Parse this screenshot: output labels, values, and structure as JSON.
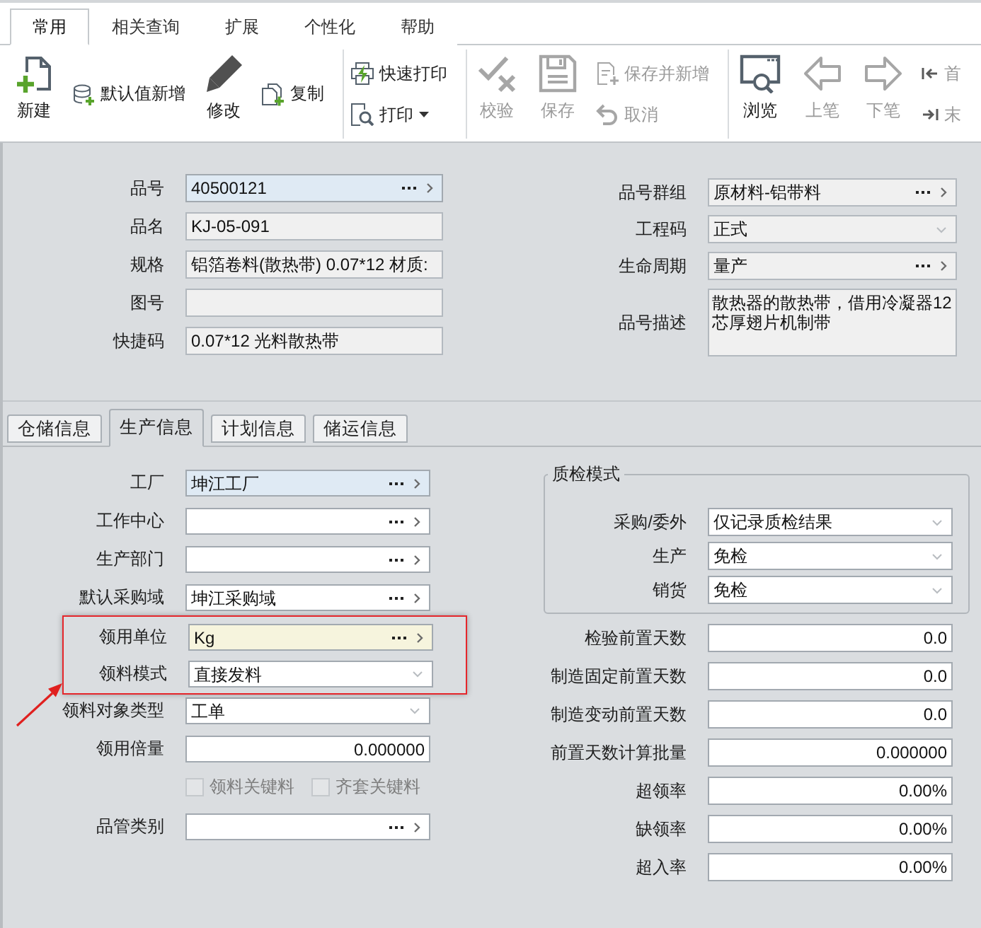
{
  "ribbon_tabs": [
    {
      "label": "常用",
      "selected": true
    },
    {
      "label": "相关查询",
      "selected": false
    },
    {
      "label": "扩展",
      "selected": false
    },
    {
      "label": "个性化",
      "selected": false
    },
    {
      "label": "帮助",
      "selected": false
    }
  ],
  "ribbon_groups": [
    {
      "items": [
        {
          "kind": "large",
          "label": "新建",
          "disabled": false
        },
        {
          "kind": "stack",
          "items": [
            {
              "label": "默认值新增",
              "disabled": false,
              "dropdown": false
            }
          ]
        },
        {
          "kind": "large",
          "label": "修改",
          "disabled": false
        },
        {
          "kind": "stack",
          "items": [
            {
              "label": "复制",
              "disabled": false,
              "dropdown": false
            }
          ]
        }
      ]
    },
    {
      "items": [
        {
          "kind": "stack",
          "items": [
            {
              "label": "快速打印",
              "disabled": false,
              "dropdown": false
            },
            {
              "label": "打印",
              "disabled": false,
              "dropdown": true
            }
          ]
        }
      ]
    },
    {
      "items": [
        {
          "kind": "large",
          "label": "校验",
          "disabled": true
        },
        {
          "kind": "large",
          "label": "保存",
          "disabled": true
        },
        {
          "kind": "stack",
          "items": [
            {
              "label": "保存并新增",
              "disabled": true,
              "dropdown": false
            },
            {
              "label": "取消",
              "disabled": true,
              "dropdown": false
            }
          ]
        }
      ]
    },
    {
      "items": [
        {
          "kind": "large",
          "label": "浏览",
          "disabled": false
        },
        {
          "kind": "large",
          "label": "上笔",
          "disabled": true
        },
        {
          "kind": "large",
          "label": "下笔",
          "disabled": true
        },
        {
          "kind": "stack",
          "items": [
            {
              "label": "首",
              "disabled": true,
              "dropdown": false
            },
            {
              "label": "末",
              "disabled": true,
              "dropdown": false
            }
          ]
        }
      ]
    }
  ],
  "header": {
    "left_fields": [
      {
        "label": "品号",
        "value": "40500121",
        "kind": "lookup",
        "required": true,
        "readonly": false,
        "focused": false
      },
      {
        "label": "品名",
        "value": "KJ-05-091",
        "kind": "text",
        "required": false,
        "readonly": true,
        "focused": false
      },
      {
        "label": "规格",
        "value": "铝箔卷料(散热带) 0.07*12 材质:",
        "kind": "text",
        "required": false,
        "readonly": true,
        "focused": false
      },
      {
        "label": "图号",
        "kind": "text",
        "required": false,
        "readonly": true,
        "focused": false
      },
      {
        "label": "快捷码",
        "value": "0.07*12 光料散热带",
        "kind": "text",
        "required": false,
        "readonly": true,
        "focused": false
      }
    ],
    "right_fields": [
      {
        "label": "品号群组",
        "value": "原材料-铝带料",
        "kind": "lookup",
        "required": false,
        "readonly": true,
        "focused": false
      },
      {
        "label": "工程码",
        "value": "正式",
        "kind": "select",
        "required": false,
        "readonly": true,
        "focused": false
      },
      {
        "label": "生命周期",
        "value": "量产",
        "kind": "lookup",
        "required": false,
        "readonly": true,
        "focused": false
      },
      {
        "label": "品号描述",
        "value": "散热器的散热带，借用冷凝器12芯厚翅片机制带",
        "kind": "textarea",
        "required": false,
        "readonly": true,
        "focused": false
      }
    ]
  },
  "detail_tabs": [
    {
      "label": "仓储信息",
      "selected": false
    },
    {
      "label": "生产信息",
      "selected": true
    },
    {
      "label": "计划信息",
      "selected": false
    },
    {
      "label": "储运信息",
      "selected": false
    }
  ],
  "production": {
    "left_rows": [
      {
        "label": "工厂",
        "value": "坤江工厂",
        "kind": "lookup",
        "required": true,
        "readonly": false,
        "focused": false
      },
      {
        "label": "工作中心",
        "kind": "lookup",
        "required": false,
        "readonly": false,
        "focused": false
      },
      {
        "label": "生产部门",
        "kind": "lookup",
        "required": false,
        "readonly": false,
        "focused": false
      },
      {
        "label": "默认采购域",
        "value": "坤江采购域",
        "kind": "lookup",
        "required": false,
        "readonly": false,
        "focused": false
      },
      {
        "kind": "callout",
        "rows": [
          {
            "label": "领用单位",
            "value": "Kg",
            "kind": "lookup",
            "required": false,
            "readonly": false,
            "focused": true
          },
          {
            "label": "领料模式",
            "value": "直接发料",
            "kind": "select",
            "required": false,
            "readonly": false,
            "focused": false
          }
        ]
      },
      {
        "label": "领料对象类型",
        "value": "工单",
        "kind": "select",
        "required": false,
        "readonly": false,
        "focused": false
      },
      {
        "label": "领用倍量",
        "value": "0.000000",
        "kind": "number",
        "required": false,
        "readonly": false,
        "focused": false
      },
      {
        "kind": "checkboxes",
        "items": [
          {
            "label": "领料关键料",
            "checked": false,
            "disabled": true
          },
          {
            "label": "齐套关键料",
            "checked": false,
            "disabled": true
          }
        ]
      },
      {
        "label": "品管类别",
        "kind": "lookup",
        "required": false,
        "readonly": false,
        "focused": false
      }
    ],
    "quality_group": {
      "title": "质检模式",
      "fields": [
        {
          "label": "采购/委外",
          "value": "仅记录质检结果",
          "kind": "select",
          "required": false,
          "readonly": false,
          "focused": false
        },
        {
          "label": "生产",
          "value": "免检",
          "kind": "select",
          "required": false,
          "readonly": false,
          "focused": false
        },
        {
          "label": "销货",
          "value": "免检",
          "kind": "select",
          "required": false,
          "readonly": false,
          "focused": false
        }
      ]
    },
    "right_fields": [
      {
        "label": "检验前置天数",
        "value": "0.0",
        "kind": "number",
        "required": false,
        "readonly": false,
        "focused": false
      },
      {
        "label": "制造固定前置天数",
        "value": "0.0",
        "kind": "number",
        "required": false,
        "readonly": false,
        "focused": false
      },
      {
        "label": "制造变动前置天数",
        "value": "0.0",
        "kind": "number",
        "required": false,
        "readonly": false,
        "focused": false
      },
      {
        "label": "前置天数计算批量",
        "value": "0.000000",
        "kind": "number",
        "required": false,
        "readonly": false,
        "focused": false
      },
      {
        "label": "超领率",
        "value": "0.00%",
        "kind": "number",
        "required": false,
        "readonly": false,
        "focused": false
      },
      {
        "label": "缺领率",
        "value": "0.00%",
        "kind": "number",
        "required": false,
        "readonly": false,
        "focused": false
      },
      {
        "label": "超入率",
        "value": "0.00%",
        "kind": "number",
        "required": false,
        "readonly": false,
        "focused": false
      }
    ]
  }
}
